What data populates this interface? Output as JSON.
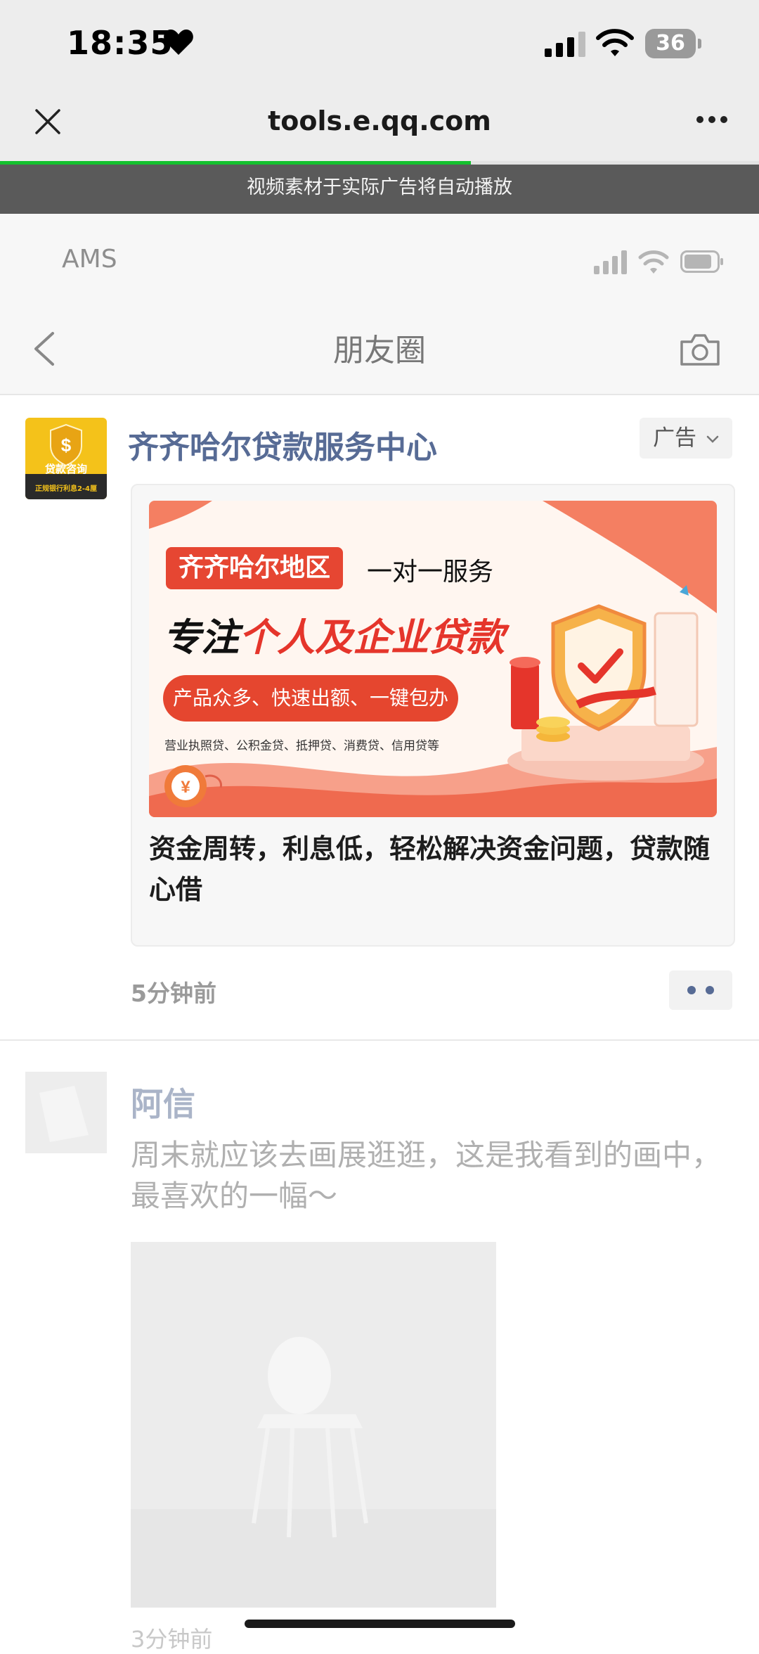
{
  "status_bar": {
    "time": "18:35",
    "battery": "36"
  },
  "browser": {
    "url": "tools.e.qq.com",
    "progress": 0.62,
    "notice": "视频素材于实际广告将自动播放"
  },
  "preview": {
    "carrier": "AMS",
    "page_title": "朋友圈"
  },
  "ad_post": {
    "avatar_text": "贷款咨询",
    "avatar_subtext": "正规银行利息2-4厘",
    "name": "齐齐哈尔贷款服务中心",
    "ad_label": "广告",
    "banner": {
      "region_tag": "齐齐哈尔地区",
      "service": "一对一服务",
      "headline_prefix": "专注",
      "headline_highlight": "个人及企业贷款",
      "pill": "产品众多、快速出额、一键包办",
      "small_text": "营业执照贷、公积金贷、抵押贷、消费贷、信用贷等"
    },
    "caption": "资金周转，利息低，轻松解决资金问题，贷款随心借",
    "time": "5分钟前"
  },
  "post2": {
    "name": "阿信",
    "text": "周末就应该去画展逛逛，这是我看到的画中，最喜欢的一幅～",
    "time": "3分钟前"
  },
  "colors": {
    "link_blue": "#576b95",
    "progress_green": "#14c12e",
    "banner_red": "#e5352b"
  }
}
